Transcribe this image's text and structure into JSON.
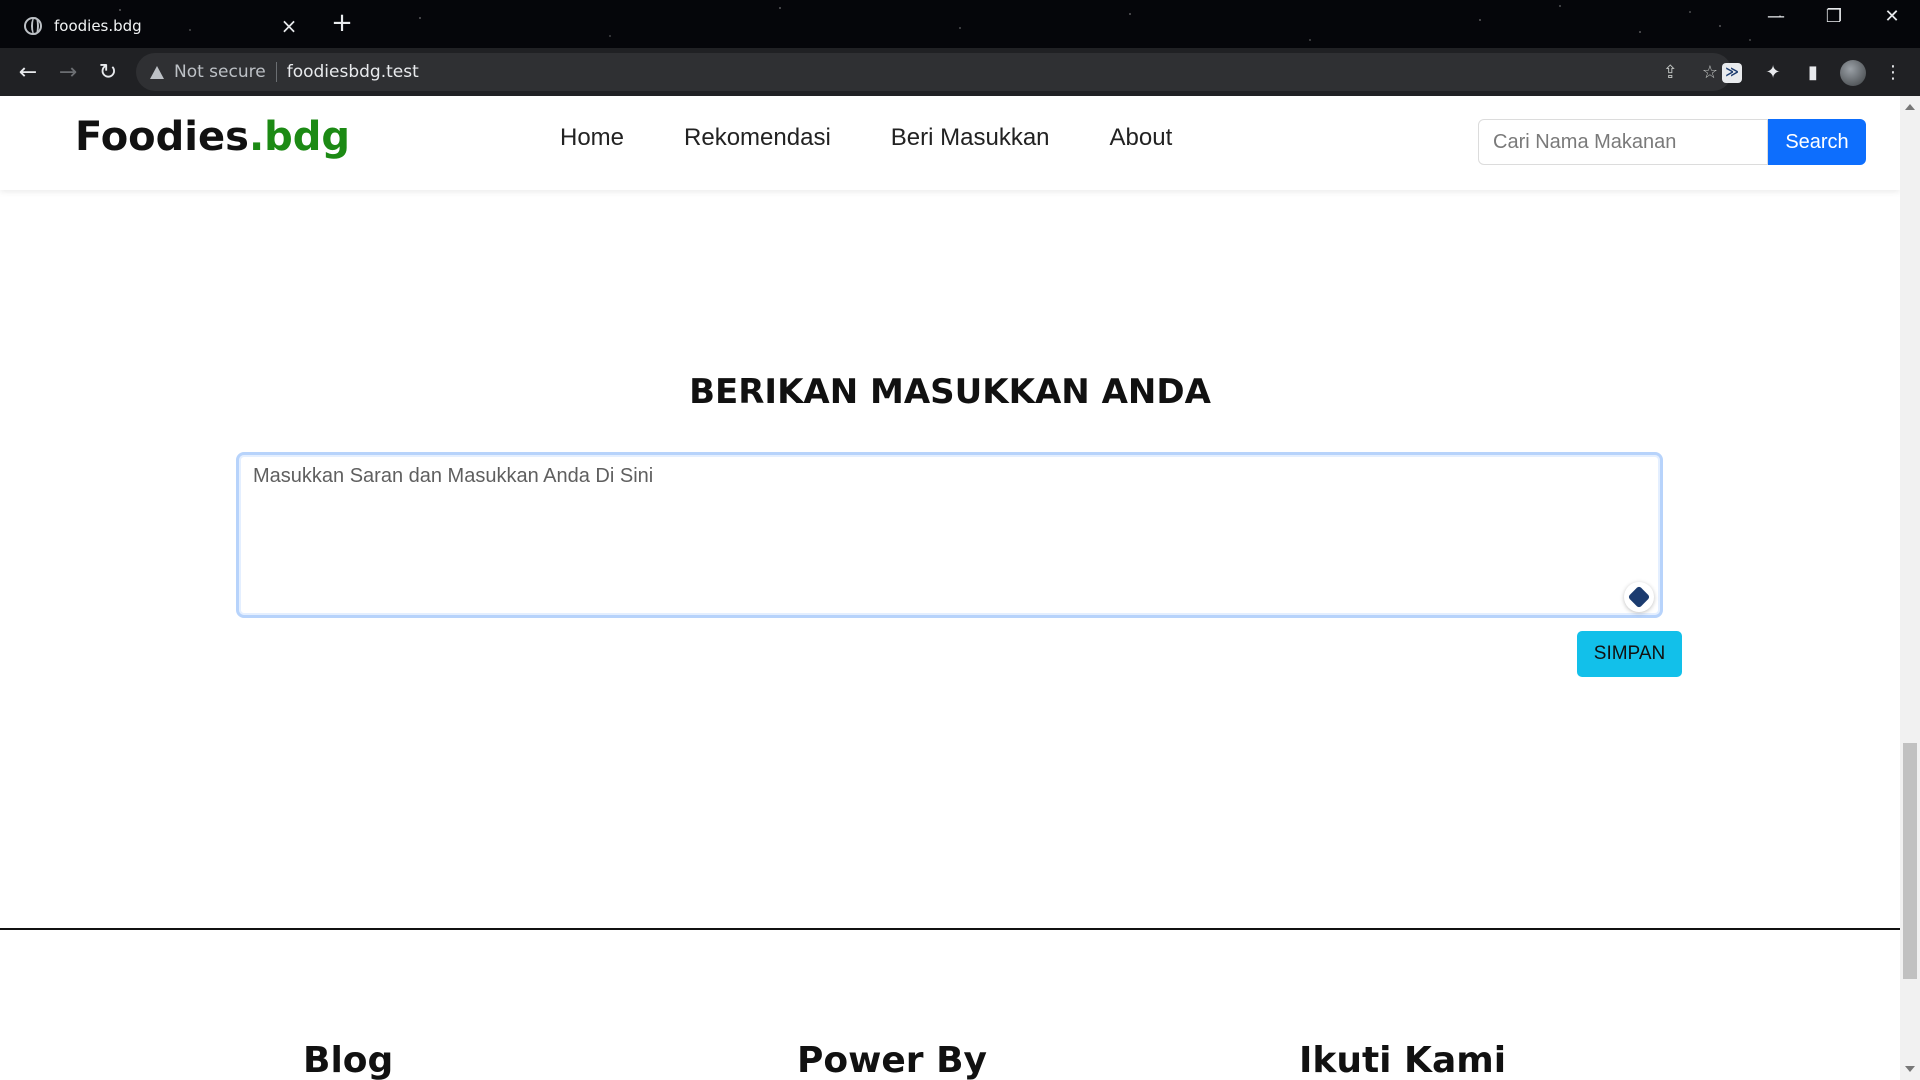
{
  "browser": {
    "tab_title": "foodies.bdg",
    "tab_close": "×",
    "new_tab": "+",
    "security_label": "Not secure",
    "url": "foodiesbdg.test",
    "back": "←",
    "forward": "→",
    "reload": "↻",
    "minimize": "—",
    "restore": "❐",
    "close": "✕",
    "share_icon": "⇪",
    "star_icon": "☆",
    "extensions_icon": "✦",
    "sidepanel_icon": "▮",
    "menu_icon": "⋮",
    "ext_badge": "≫"
  },
  "nav": {
    "brand_main": "Foodies",
    "brand_accent": ".bdg",
    "items": [
      {
        "label": "Home"
      },
      {
        "label": "Rekomendasi"
      },
      {
        "label": "Beri Masukkan"
      },
      {
        "label": "About"
      }
    ],
    "search": {
      "placeholder": "Cari Nama Makanan",
      "button_label": "Search"
    }
  },
  "main": {
    "heading": "BERIKAN MASUKKAN ANDA",
    "textarea_placeholder": "Masukkan Saran dan Masukkan Anda Di Sini",
    "save_label": "SIMPAN"
  },
  "footer": {
    "columns": [
      {
        "title": "Blog"
      },
      {
        "title": "Power By"
      },
      {
        "title": "Ikuti Kami"
      }
    ]
  },
  "colors": {
    "brand_accent": "#1c8a14",
    "search_button": "#0d6efd",
    "save_button": "#12c0ea",
    "toolbar": "#202124"
  }
}
